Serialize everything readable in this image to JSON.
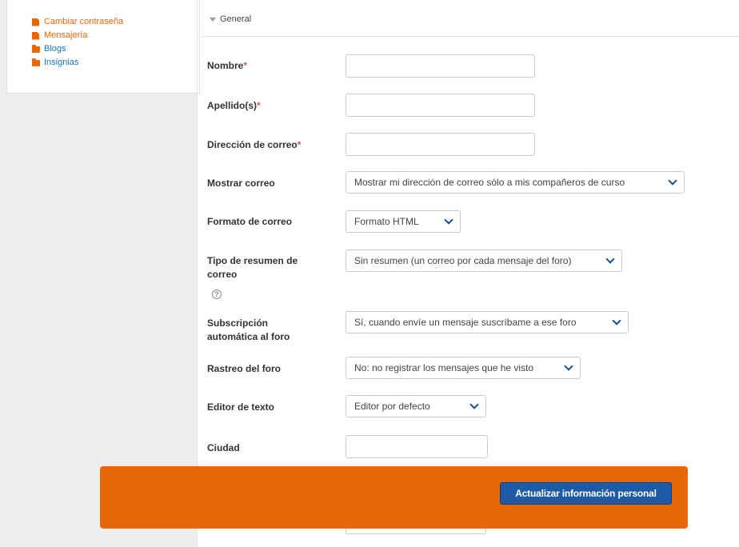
{
  "sidebar": {
    "items": [
      {
        "label": "Cambiar contraseña",
        "icon": "document-icon",
        "color": "#e8670a"
      },
      {
        "label": "Mensajería",
        "icon": "document-icon",
        "color": "#e8670a"
      },
      {
        "label": "Blogs",
        "icon": "folder-icon",
        "color": "#1a72b6"
      },
      {
        "label": "Insignias",
        "icon": "folder-icon",
        "color": "#1a72b6"
      }
    ]
  },
  "form": {
    "section_title": "General",
    "fields": {
      "nombre": {
        "label": "Nombre",
        "required": "*",
        "value": ""
      },
      "apellido": {
        "label": "Apellido(s)",
        "required": "*",
        "value": ""
      },
      "correo": {
        "label": "Dirección de correo",
        "required": "*",
        "value": ""
      },
      "mostrar_correo": {
        "label": "Mostrar correo",
        "selected": "Mostrar mi dirección de correo sólo a mis compañeros de curso"
      },
      "formato_correo": {
        "label": "Formato de correo",
        "selected": "Formato HTML"
      },
      "tipo_resumen": {
        "label_line1": "Tipo de resumen de",
        "label_line2": "correo",
        "help": "?",
        "selected": "Sin resumen (un correo por cada mensaje del foro)"
      },
      "suscripcion": {
        "label_line1": "Subscripción",
        "label_line2": "automática al foro",
        "selected": "Sí, cuando envíe un mensaje suscríbame a ese foro"
      },
      "rastreo": {
        "label": "Rastreo del foro",
        "selected": "No: no registrar los mensajes que he visto"
      },
      "editor": {
        "label": "Editor de texto",
        "selected": "Editor por defecto"
      },
      "ciudad": {
        "label": "Ciudad",
        "value": ""
      }
    }
  },
  "footer": {
    "update_button_label": "Actualizar información personal",
    "accent_color": "#e8670a",
    "button_color": "#1f5aa6"
  }
}
